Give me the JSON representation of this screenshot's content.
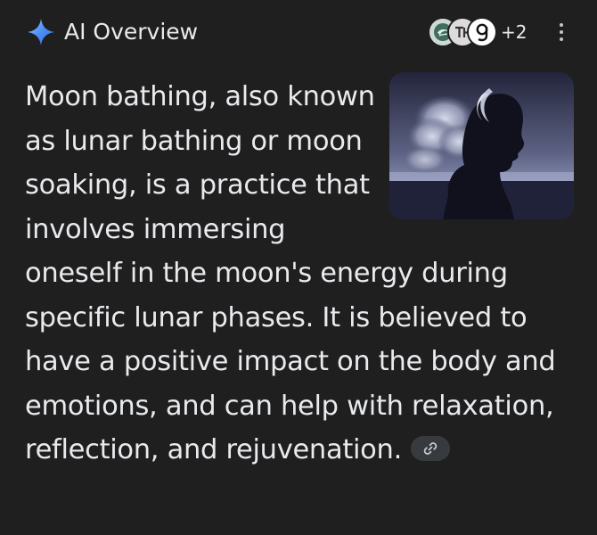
{
  "header": {
    "title": "AI Overview",
    "sources_more": "+2",
    "source_icons": [
      "source-favicon-1",
      "source-favicon-2",
      "source-favicon-3"
    ]
  },
  "answer": {
    "text": "Moon bathing, also known as lunar bathing or moon soaking, is a practice that involves immersing oneself in the moon's energy during specific lunar phases. It is believed to have a positive impact on the body and emotions, and can help with relaxation, reflection, and rejuvenation."
  },
  "colors": {
    "background": "#1f1f1f",
    "text": "#e8eaed",
    "spark_accent": "#4c8df6",
    "chip": "#373a3f"
  }
}
